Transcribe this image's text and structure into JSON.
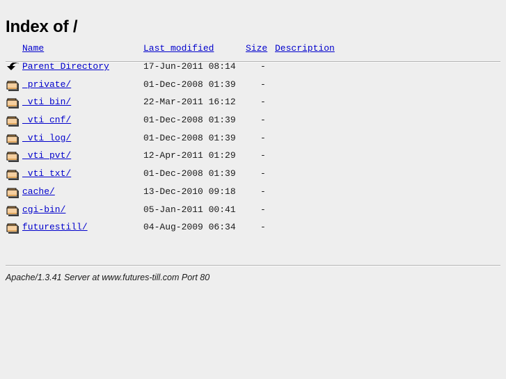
{
  "page": {
    "title": "Index of /",
    "background_color": "#eeeeee",
    "link_color": "#0000cc",
    "text_color": "#1a1a1a"
  },
  "table": {
    "headers": {
      "name": "Name",
      "last_modified": "Last modified",
      "size": "Size",
      "description": "Description"
    },
    "rows": [
      {
        "icon": "back-arrow-icon",
        "name": "Parent Directory",
        "last_modified": "17-Jun-2011 08:14",
        "size": "-",
        "description": ""
      },
      {
        "icon": "folder-icon",
        "name": "_private/",
        "last_modified": "01-Dec-2008 01:39",
        "size": "-",
        "description": ""
      },
      {
        "icon": "folder-icon",
        "name": "_vti_bin/",
        "last_modified": "22-Mar-2011 16:12",
        "size": "-",
        "description": ""
      },
      {
        "icon": "folder-icon",
        "name": "_vti_cnf/",
        "last_modified": "01-Dec-2008 01:39",
        "size": "-",
        "description": ""
      },
      {
        "icon": "folder-icon",
        "name": "_vti_log/",
        "last_modified": "01-Dec-2008 01:39",
        "size": "-",
        "description": ""
      },
      {
        "icon": "folder-icon",
        "name": "_vti_pvt/",
        "last_modified": "12-Apr-2011 01:29",
        "size": "-",
        "description": ""
      },
      {
        "icon": "folder-icon",
        "name": "_vti_txt/",
        "last_modified": "01-Dec-2008 01:39",
        "size": "-",
        "description": ""
      },
      {
        "icon": "folder-icon",
        "name": "cache/",
        "last_modified": "13-Dec-2010 09:18",
        "size": "-",
        "description": ""
      },
      {
        "icon": "folder-icon",
        "name": "cgi-bin/",
        "last_modified": "05-Jan-2011 00:41",
        "size": "-",
        "description": ""
      },
      {
        "icon": "folder-icon",
        "name": "futurestill/",
        "last_modified": "04-Aug-2009 06:34",
        "size": "-",
        "description": ""
      }
    ]
  },
  "footer": {
    "signature": "Apache/1.3.41 Server at www.futures-till.com Port 80"
  }
}
